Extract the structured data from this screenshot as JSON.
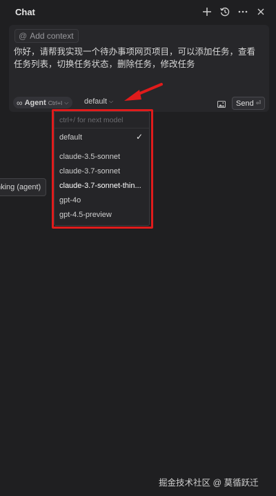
{
  "header": {
    "title": "Chat",
    "icons": [
      "plus-icon",
      "history-icon",
      "more-icon",
      "close-icon"
    ]
  },
  "composer": {
    "context_at": "@",
    "context_label": "Add context",
    "message": "你好，请帮我实现一个待办事项网页项目，可以添加任务，查看任务列表，切换任务状态，删除任务，修改任务",
    "agent": {
      "symbol": "∞",
      "label": "Agent",
      "shortcut": "Ctrl+I",
      "chevron": "⌵"
    },
    "model": {
      "value": "default",
      "chevron": "⌵"
    },
    "send": {
      "label": "Send",
      "return_glyph": "⏎"
    }
  },
  "dropdown": {
    "hint": "ctrl+/ for next model",
    "check": "✓",
    "items": [
      {
        "label": "default",
        "selected": true
      },
      {
        "label": "claude-3.5-sonnet"
      },
      {
        "label": "claude-3.7-sonnet"
      },
      {
        "label": "claude-3.7-sonnet-thin..."
      },
      {
        "label": "gpt-4o"
      },
      {
        "label": "gpt-4.5-preview"
      }
    ]
  },
  "tooltip": {
    "text": "nking (agent)"
  },
  "watermark": "掘金技术社区 @ 莫循跃迁",
  "colors": {
    "highlight": "#e01b1b",
    "background": "#1f1f21",
    "panel": "#27272a"
  }
}
